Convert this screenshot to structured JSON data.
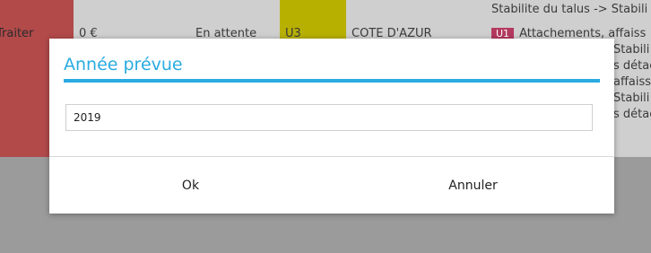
{
  "background_row": {
    "status": "Traiter",
    "amount": "0 €",
    "state": "En attente",
    "urgency": "U3",
    "region": "COTE D'AZUR",
    "desc_line1": "Stabilite du talus -> Stabili",
    "desc_tag": "U1",
    "desc_line2": "Attachements, affaiss",
    "desc_line3": "Stabili",
    "desc_line4": "s détac",
    "desc_line5": "affaiss",
    "desc_line6": "Stabili",
    "desc_line7": "s détac"
  },
  "dialog": {
    "title": "Année prévue",
    "input_value": "2019",
    "ok_label": "Ok",
    "cancel_label": "Annuler"
  },
  "colors": {
    "accent": "#29abe2",
    "status_red": "#b24a4a",
    "urgency_yellow": "#b7b000",
    "tag_pink": "#b3395f",
    "overlay": "#9b9b9b"
  }
}
